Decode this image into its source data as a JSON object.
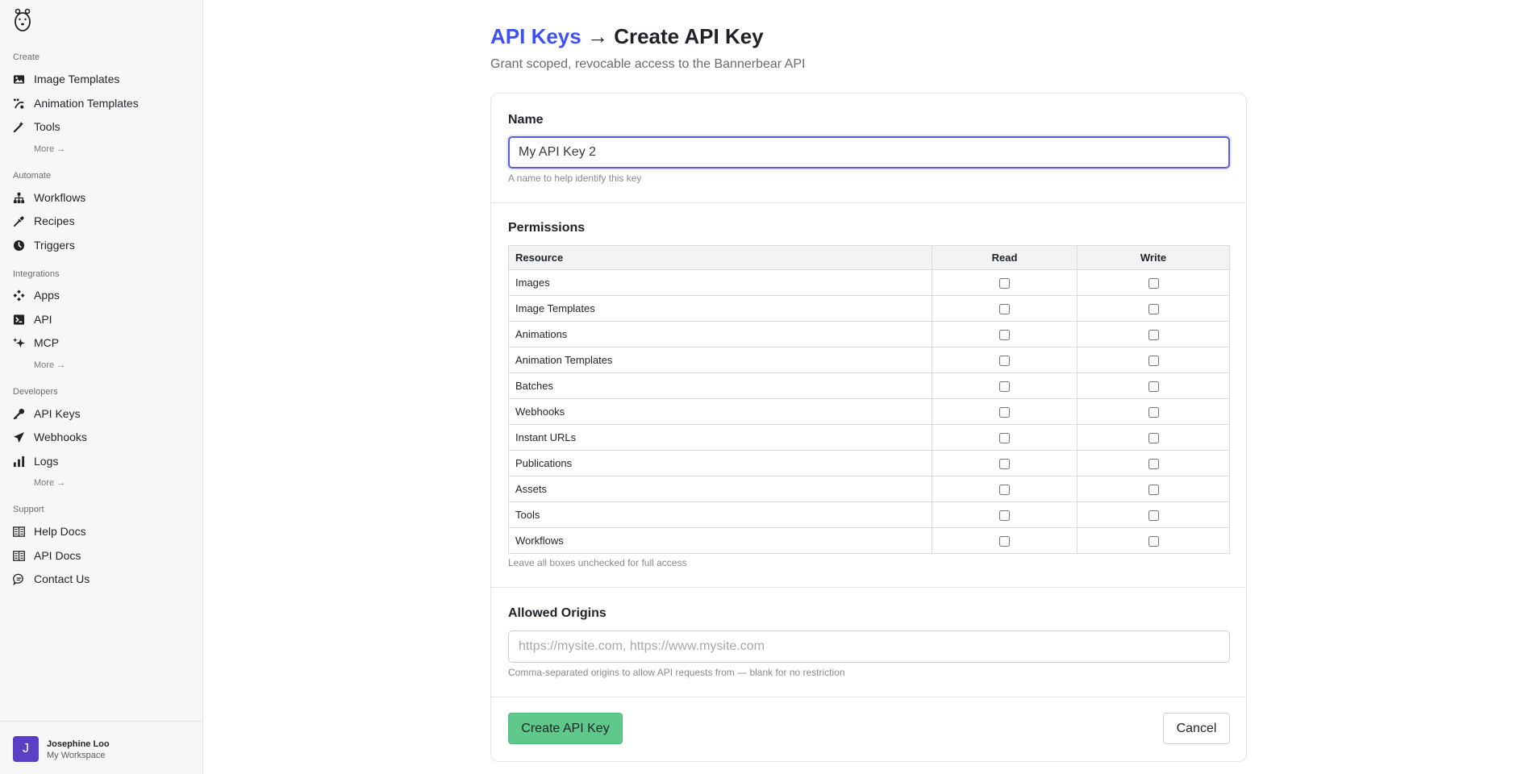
{
  "sidebar": {
    "logo_icon": "bear-logo-icon",
    "sections": [
      {
        "label": "Create"
      },
      {
        "label": "Automate"
      },
      {
        "label": "Integrations"
      },
      {
        "label": "Developers"
      },
      {
        "label": "Support"
      }
    ],
    "items": [
      {
        "label": "Image Templates",
        "icon": "image-icon"
      },
      {
        "label": "Animation Templates",
        "icon": "animation-icon"
      },
      {
        "label": "Tools",
        "icon": "magic-wand-icon"
      },
      {
        "label": "Workflows",
        "icon": "sitemap-icon"
      },
      {
        "label": "Recipes",
        "icon": "eyedropper-icon"
      },
      {
        "label": "Triggers",
        "icon": "clock-icon"
      },
      {
        "label": "Apps",
        "icon": "apps-icon"
      },
      {
        "label": "API",
        "icon": "terminal-icon"
      },
      {
        "label": "MCP",
        "icon": "sparkles-icon"
      },
      {
        "label": "API Keys",
        "icon": "key-icon"
      },
      {
        "label": "Webhooks",
        "icon": "paper-plane-icon"
      },
      {
        "label": "Logs",
        "icon": "bar-chart-icon"
      },
      {
        "label": "Help Docs",
        "icon": "book-icon"
      },
      {
        "label": "API Docs",
        "icon": "book-icon"
      },
      {
        "label": "Contact Us",
        "icon": "chat-icon"
      }
    ],
    "more_label": "More →"
  },
  "user": {
    "initial": "J",
    "name": "Josephine Loo",
    "workspace": "My Workspace",
    "avatar_color": "#5b3fc4"
  },
  "header": {
    "breadcrumb": "API Keys",
    "arrow": " → ",
    "title": "Create API Key",
    "subtitle": "Grant scoped, revocable access to the Bannerbear API"
  },
  "form": {
    "name_label": "Name",
    "name_value": "My API Key 2",
    "name_hint": "A name to help identify this key",
    "permissions_label": "Permissions",
    "columns": [
      "Resource",
      "Read",
      "Write"
    ],
    "resources": [
      {
        "name": "Images",
        "read": false,
        "write": false
      },
      {
        "name": "Image Templates",
        "read": false,
        "write": false
      },
      {
        "name": "Animations",
        "read": false,
        "write": false
      },
      {
        "name": "Animation Templates",
        "read": false,
        "write": false
      },
      {
        "name": "Batches",
        "read": false,
        "write": false
      },
      {
        "name": "Webhooks",
        "read": false,
        "write": false
      },
      {
        "name": "Instant URLs",
        "read": false,
        "write": false
      },
      {
        "name": "Publications",
        "read": false,
        "write": false
      },
      {
        "name": "Assets",
        "read": false,
        "write": false
      },
      {
        "name": "Tools",
        "read": false,
        "write": false
      },
      {
        "name": "Workflows",
        "read": false,
        "write": false
      }
    ],
    "permissions_hint": "Leave all boxes unchecked for full access",
    "origins_label": "Allowed Origins",
    "origins_value": "",
    "origins_placeholder": "https://mysite.com, https://www.mysite.com",
    "origins_hint": "Comma-separated origins to allow API requests from — blank for no restriction",
    "create_label": "Create API Key",
    "cancel_label": "Cancel"
  },
  "colors": {
    "accent": "#3f51f5",
    "primary_button": "#5fc88b",
    "focus_border": "#5b5be0"
  }
}
